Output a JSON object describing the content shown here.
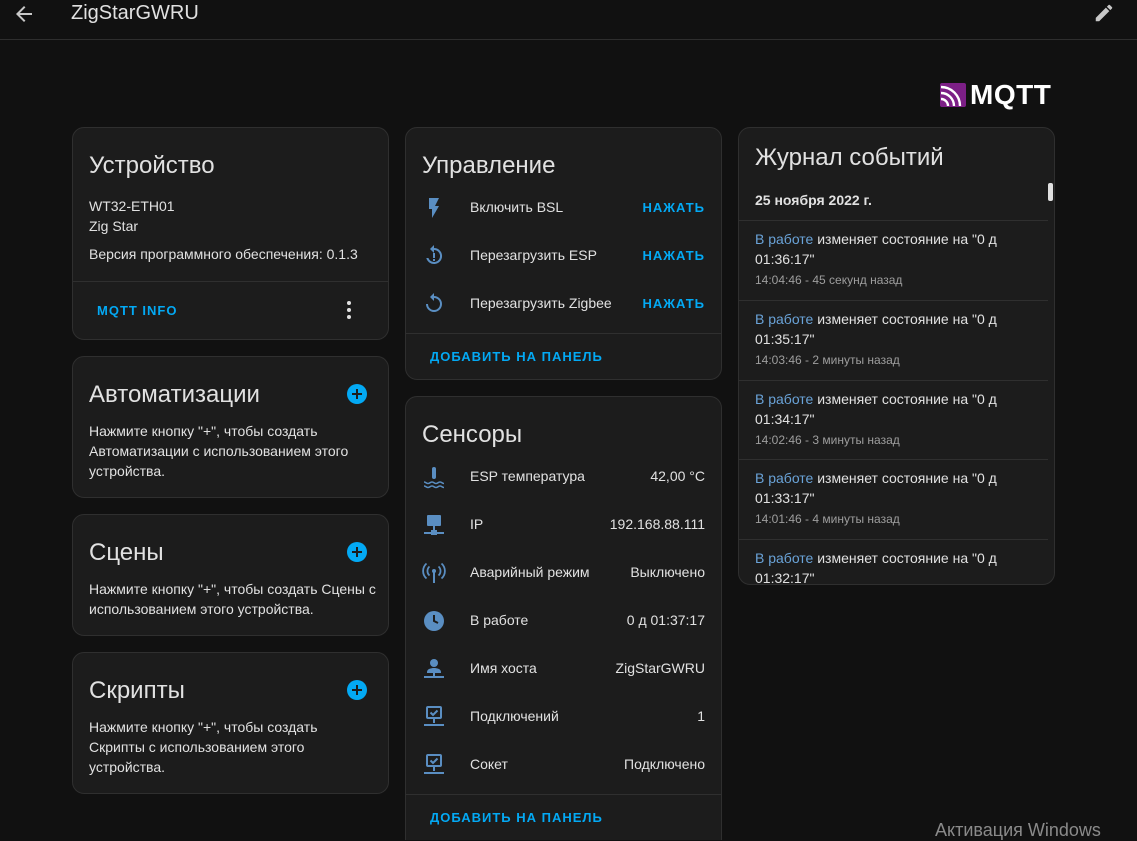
{
  "header": {
    "title": "ZigStarGWRU",
    "back_icon": "arrow-left-icon",
    "edit_icon": "pencil-icon"
  },
  "integration_logo": {
    "text": "MQTT",
    "color": "#7c1f86"
  },
  "device": {
    "title": "Устройство",
    "model": "WT32-ETH01",
    "manufacturer": "Zig Star",
    "firmware": "Версия программного обеспечения: 0.1.3",
    "mqtt_info_label": "MQTT INFO"
  },
  "automations": {
    "title": "Автоматизации",
    "text": "Нажмите кнопку \"+\", чтобы создать Автоматизации с использованием этого устройства."
  },
  "scenes": {
    "title": "Сцены",
    "text": "Нажмите кнопку \"+\", чтобы создать Сцены с использованием этого устройства."
  },
  "scripts": {
    "title": "Скрипты",
    "text": "Нажмите кнопку \"+\", чтобы создать Скрипты с использованием этого устройства."
  },
  "controls": {
    "title": "Управление",
    "items": [
      {
        "label": "Включить BSL",
        "action": "НАЖАТЬ",
        "icon": "flash-icon"
      },
      {
        "label": "Перезагрузить ESP",
        "action": "НАЖАТЬ",
        "icon": "restart-alert-icon"
      },
      {
        "label": "Перезагрузить Zigbee",
        "action": "НАЖАТЬ",
        "icon": "restart-icon"
      }
    ],
    "add_label": "ДОБАВИТЬ НА ПАНЕЛЬ"
  },
  "sensors": {
    "title": "Сенсоры",
    "items": [
      {
        "label": "ESP температура",
        "value": "42,00 °C",
        "icon": "thermometer-water-icon"
      },
      {
        "label": "IP",
        "value": "192.168.88.111",
        "icon": "network-icon"
      },
      {
        "label": "Аварийный режим",
        "value": "Выключено",
        "icon": "access-point-icon"
      },
      {
        "label": "В работе",
        "value": "0 д 01:37:17",
        "icon": "clock-icon"
      },
      {
        "label": "Имя хоста",
        "value": "ZigStarGWRU",
        "icon": "account-network-icon"
      },
      {
        "label": "Подключений",
        "value": "1",
        "icon": "lan-check-icon"
      },
      {
        "label": "Сокет",
        "value": "Подключено",
        "icon": "lan-connect-icon"
      }
    ],
    "add_label": "ДОБАВИТЬ НА ПАНЕЛЬ"
  },
  "logbook": {
    "title": "Журнал событий",
    "date": "25 ноября 2022 г.",
    "entries": [
      {
        "entity": "В работе",
        "text": " изменяет состояние на \"0 д 01:36:17\"",
        "time": "14:04:46 - 45 секунд назад"
      },
      {
        "entity": "В работе",
        "text": " изменяет состояние на \"0 д 01:35:17\"",
        "time": "14:03:46 - 2 минуты назад"
      },
      {
        "entity": "В работе",
        "text": " изменяет состояние на \"0 д 01:34:17\"",
        "time": "14:02:46 - 3 минуты назад"
      },
      {
        "entity": "В работе",
        "text": " изменяет состояние на \"0 д 01:33:17\"",
        "time": "14:01:46 - 4 минуты назад"
      },
      {
        "entity": "В работе",
        "text": " изменяет состояние на \"0 д 01:32:17\"",
        "time": ""
      }
    ]
  },
  "watermark": "Активация Windows",
  "colors": {
    "accent": "#03a9f4",
    "card": "#1c1c1c",
    "background": "#111111",
    "icon": "#5a8ec2"
  }
}
